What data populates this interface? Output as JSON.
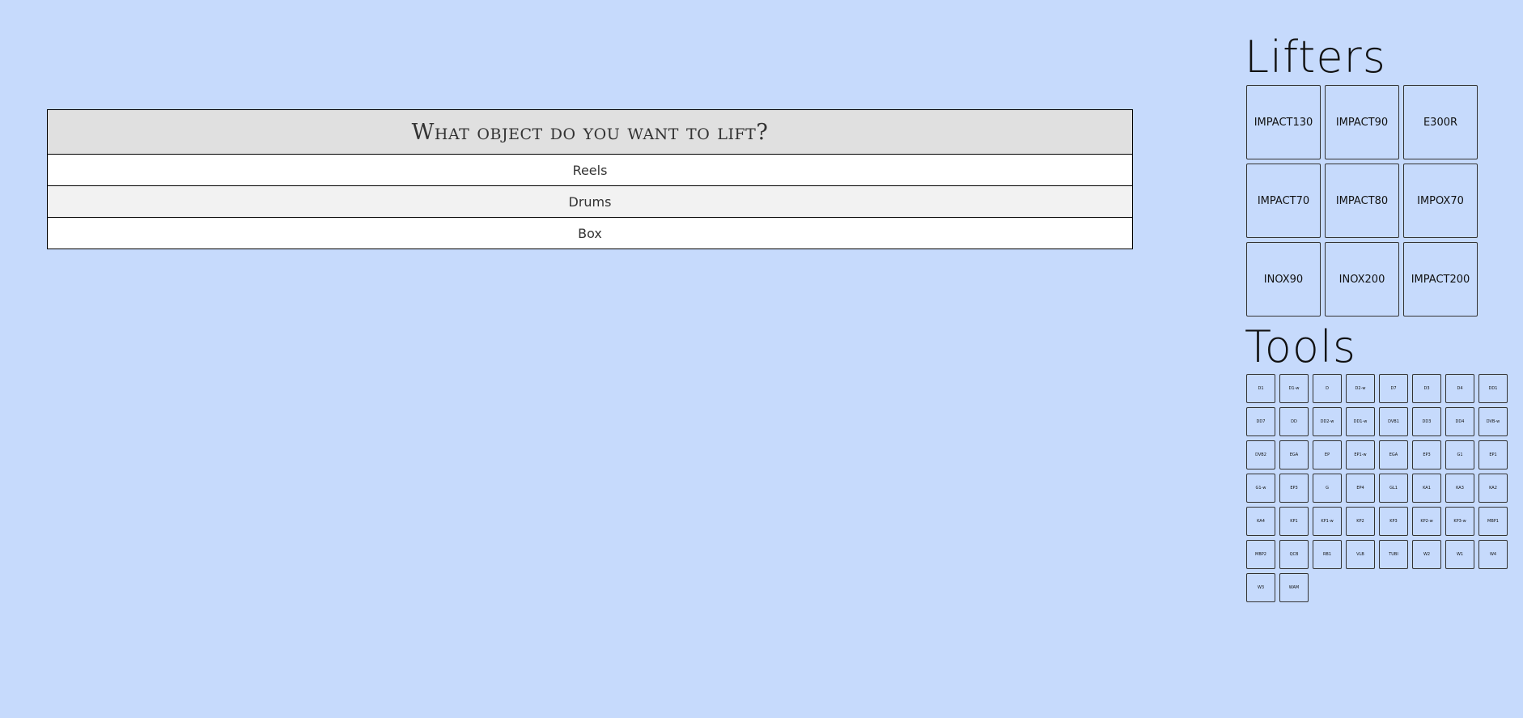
{
  "question": {
    "title": "What object do you want to lift?",
    "options": [
      {
        "label": "Reels"
      },
      {
        "label": "Drums"
      },
      {
        "label": "Box"
      }
    ]
  },
  "lifters": {
    "heading": "Lifters",
    "items": [
      {
        "label": "IMPACT130"
      },
      {
        "label": "IMPACT90"
      },
      {
        "label": "E300R"
      },
      {
        "label": "IMPACT70"
      },
      {
        "label": "IMPACT80"
      },
      {
        "label": "IMPOX70"
      },
      {
        "label": "INOX90"
      },
      {
        "label": "INOX200"
      },
      {
        "label": "IMPACT200"
      }
    ]
  },
  "tools": {
    "heading": "Tools",
    "items": [
      {
        "label": "D1"
      },
      {
        "label": "D1-w"
      },
      {
        "label": "D"
      },
      {
        "label": "D2-w"
      },
      {
        "label": "D7"
      },
      {
        "label": "D3"
      },
      {
        "label": "D4"
      },
      {
        "label": "DD1"
      },
      {
        "label": "DD7"
      },
      {
        "label": "DD"
      },
      {
        "label": "DD2-w"
      },
      {
        "label": "DD1-w"
      },
      {
        "label": "DVB1"
      },
      {
        "label": "DD3"
      },
      {
        "label": "DD4"
      },
      {
        "label": "DVB-w"
      },
      {
        "label": "DVB2"
      },
      {
        "label": "EGA"
      },
      {
        "label": "EP"
      },
      {
        "label": "EP1-w"
      },
      {
        "label": "EGA"
      },
      {
        "label": "EP3"
      },
      {
        "label": "G1"
      },
      {
        "label": "EP1"
      },
      {
        "label": "G1-w"
      },
      {
        "label": "EP3"
      },
      {
        "label": "G"
      },
      {
        "label": "EP4"
      },
      {
        "label": "GL1"
      },
      {
        "label": "KA1"
      },
      {
        "label": "KA3"
      },
      {
        "label": "KA2"
      },
      {
        "label": "KA4"
      },
      {
        "label": "KP1"
      },
      {
        "label": "KP1-w"
      },
      {
        "label": "KP2"
      },
      {
        "label": "KP3"
      },
      {
        "label": "KP2-w"
      },
      {
        "label": "KP3-w"
      },
      {
        "label": "MBP1"
      },
      {
        "label": "MBP2"
      },
      {
        "label": "QCB"
      },
      {
        "label": "RB1"
      },
      {
        "label": "VLB"
      },
      {
        "label": "TUBI"
      },
      {
        "label": "W2"
      },
      {
        "label": "W1"
      },
      {
        "label": "W4"
      },
      {
        "label": "W3"
      },
      {
        "label": "WAM"
      }
    ]
  },
  "colors": {
    "background": "#c6dafc",
    "header_bg": "#e0e0e0",
    "row_odd": "#ffffff",
    "row_even": "#f2f2f2"
  }
}
